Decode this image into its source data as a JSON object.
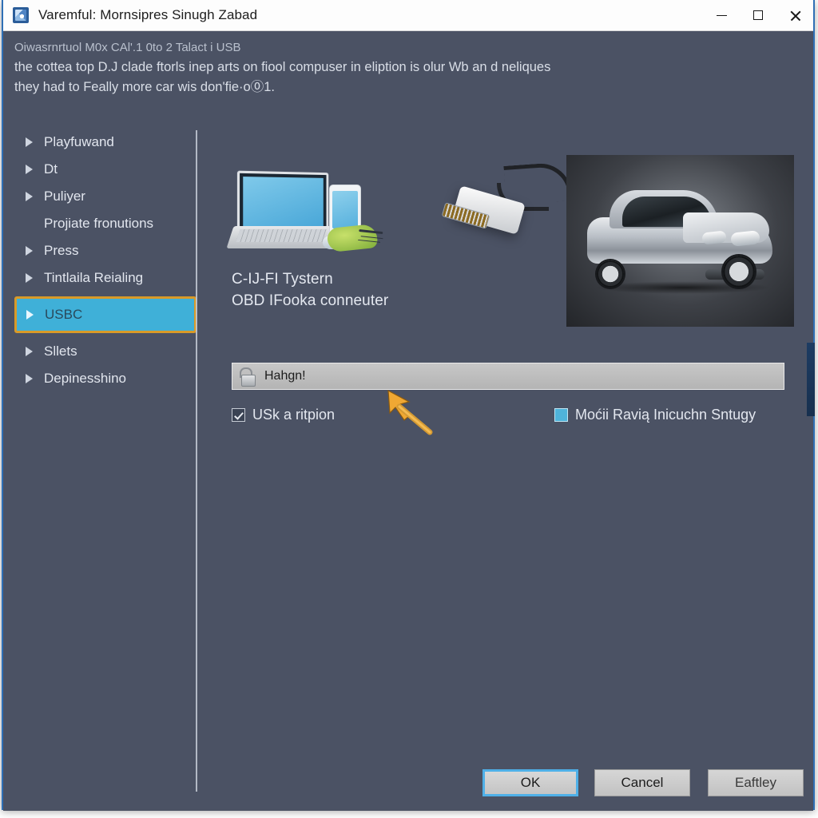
{
  "window": {
    "title": "Varemful: Mornsipres Sinugh Zabad",
    "app_icon": "app-shield-icon",
    "controls": {
      "minimize": "minimize-icon",
      "maximize": "maximize-icon",
      "close": "close-icon"
    }
  },
  "intro": {
    "line1": "Oiwasrnrtuol M0x CAl'.1 0to 2 Talact i USB",
    "line2": "the cottea top D.J clade ftorls inep arts on fiool compuser in eliption is olur Wb an d neliques",
    "line3": "they had to Feally more car wis don'fie·o⓪1."
  },
  "sidebar": {
    "items": [
      {
        "label": "Playfuwand",
        "caret": true
      },
      {
        "label": "Dt",
        "caret": true
      },
      {
        "label": "Puliyer",
        "caret": true
      },
      {
        "label": "Projiate fronutions",
        "caret": false
      },
      {
        "label": "Press",
        "caret": true
      },
      {
        "label": "Tintlaila Reialing",
        "caret": true
      }
    ],
    "selected": {
      "label": "USBC",
      "caret": true,
      "highlight_color": "#3fb0d8",
      "focus_color": "#d99a28"
    },
    "items_after": [
      {
        "label": "Sllets",
        "caret": true
      },
      {
        "label": "Depinesshino",
        "caret": true
      }
    ]
  },
  "main": {
    "illustration_left": "laptop-phone-devices-image",
    "illustration_mid": "obd-usb-connector-image",
    "photo_right": "silver-sports-car-photo",
    "captions": {
      "line1": "C-IJ-FI Tystern",
      "line2": "OBD IFooka conneuter"
    },
    "lockbar": {
      "icon": "open-padlock-icon",
      "text": "Hahgn!"
    },
    "checkboxes": [
      {
        "label": "USk a ritpion",
        "checked": true,
        "style": "check"
      },
      {
        "label": "Moćii Ravią Inicuchn Sntugy",
        "checked": false,
        "style": "filled"
      }
    ],
    "cursor": "orange-arrow-cursor"
  },
  "footer": {
    "ok": "OK",
    "cancel": "Cancel",
    "apply": "Eaftley"
  },
  "colors": {
    "background": "#4b5264",
    "accent_blue": "#3fb0d8",
    "focus_orange": "#d99a28",
    "window_border": "#2f6fb5",
    "cursor_orange": "#e8a43a"
  }
}
